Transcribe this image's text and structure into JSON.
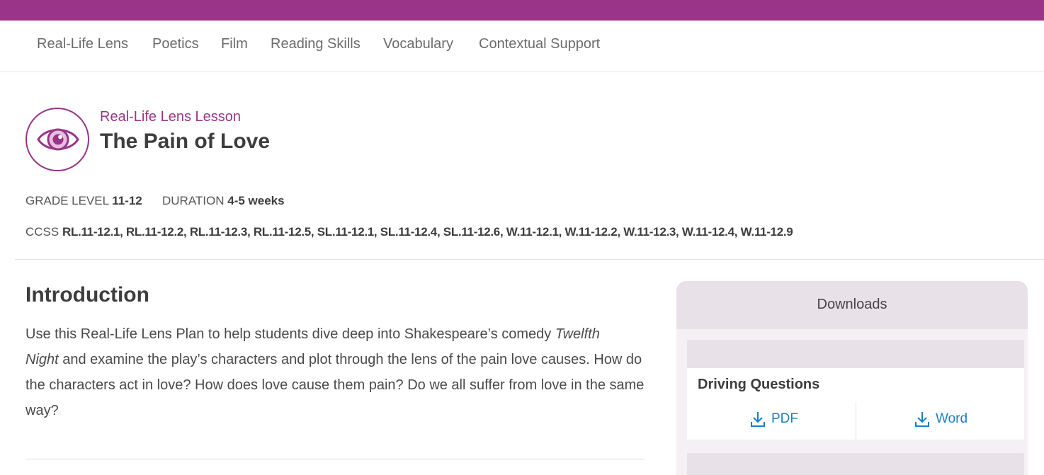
{
  "colors": {
    "brand": "#993488",
    "link": "#1a7fc1",
    "panel": "#e9e1e8"
  },
  "nav": {
    "items": [
      "Real-Life Lens",
      "Poetics",
      "Film",
      "Reading Skills",
      "Vocabulary",
      "Contextual Support"
    ]
  },
  "lesson": {
    "icon": "eye-icon",
    "kicker": "Real-Life Lens Lesson",
    "title": "The Pain of Love",
    "grade_label": "GRADE LEVEL",
    "grade_value": "11-12",
    "duration_label": "DURATION",
    "duration_value": "4-5 weeks",
    "ccss_label": "CCSS",
    "ccss_codes": "RL.11-12.1, RL.11-12.2, RL.11-12.3, RL.11-12.5, SL.11-12.1, SL.11-12.4, SL.11-12.6, W.11-12.1, W.11-12.2, W.11-12.3, W.11-12.4, W.11-12.9"
  },
  "intro": {
    "heading": "Introduction",
    "text_1": "Use this Real-Life Lens Plan to help students dive deep into Shakespeare’s comedy ",
    "text_em_1": "Twelfth",
    "text_em_2": "Night",
    "text_2": " and examine the play’s characters and plot through the lens of the pain love causes. How do the characters act in love? How does love cause them pain? Do we all suffer from love in the same way?"
  },
  "downloads": {
    "heading": "Downloads",
    "items": [
      {
        "title": "Driving Questions",
        "pdf_label": "PDF",
        "word_label": "Word",
        "icon": "download-icon"
      }
    ]
  }
}
